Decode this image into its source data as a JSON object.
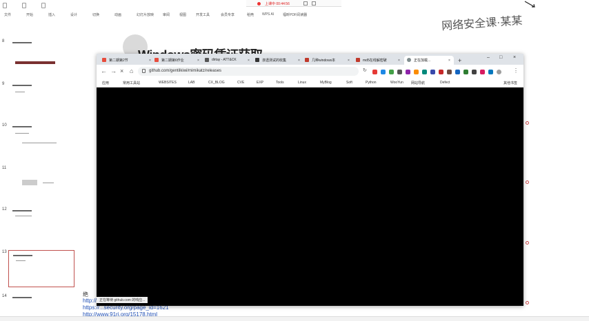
{
  "ppt": {
    "recording_text": "上课中 00:44:56",
    "ribbon_tabs": [
      "文件",
      "开始",
      "插入",
      "设计",
      "切换",
      "动画",
      "幻灯片放映",
      "审阅",
      "视图",
      "开发工具",
      "会员专享",
      "稻壳",
      "WPS AI",
      "福昕PDF阅读器"
    ],
    "slide_numbers": [
      "8",
      "9",
      "10",
      "11",
      "12",
      "13",
      "14"
    ]
  },
  "slide": {
    "heading": "Windows密码凭证获取",
    "heading_right": "网络安全课·某某",
    "lines": [
      "绝",
      "http://www.secwiki.org/",
      "https://...security.org/page_id=1621",
      "http://www.91ri.org/15178.html"
    ]
  },
  "browser": {
    "tabs": [
      {
        "label": "第二期第2节",
        "color": "#e74c3c"
      },
      {
        "label": "第二期第6作业",
        "color": "#e74c3c"
      },
      {
        "label": "dirtay - ATT&CK",
        "color": "#555555"
      },
      {
        "label": "渗透测试的收集",
        "color": "#333333"
      },
      {
        "label": "几种windows本",
        "color": "#c0392b"
      },
      {
        "label": "md5在线解密破",
        "color": "#c0392b"
      },
      {
        "label": "正在加载...",
        "color": "#7f8c8d"
      }
    ],
    "url": "github.com/gentilkiwi/mimikatz/releases",
    "bookmarks": [
      "应用",
      "常用工具站",
      "WEBSITES",
      "LAB",
      "CX_BLOG",
      "CVE",
      "EXP",
      "Tools",
      "Linux",
      "MyBlog",
      "Soft",
      "Python",
      "WooYun",
      "网站导航",
      "Defect",
      "其他书签"
    ],
    "status": "正在等待 github.com 的响应..."
  }
}
